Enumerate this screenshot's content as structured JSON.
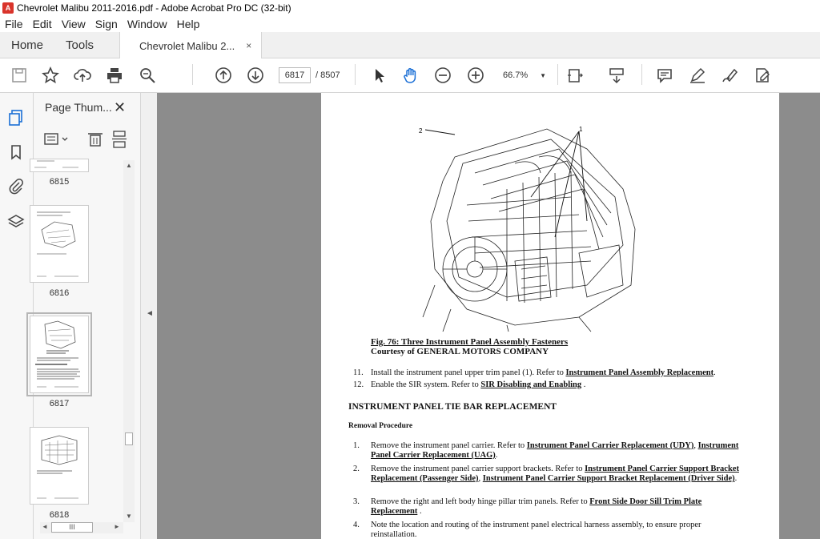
{
  "window": {
    "title": "Chevrolet Malibu 2011-2016.pdf - Adobe Acrobat Pro DC (32-bit)",
    "app_icon": "acrobat-icon"
  },
  "menu": {
    "items": [
      "File",
      "Edit",
      "View",
      "Sign",
      "Window",
      "Help"
    ]
  },
  "tabs": {
    "home": "Home",
    "tools": "Tools",
    "document": "Chevrolet Malibu 2...",
    "close": "×"
  },
  "toolbar": {
    "current_page": "6817",
    "total_pages": "/ 8507",
    "zoom": "66.7%"
  },
  "thumbnails": {
    "title": "Page Thum...",
    "close": "✕",
    "pages": [
      {
        "label": "6815"
      },
      {
        "label": "6816"
      },
      {
        "label": "6817",
        "selected": true
      },
      {
        "label": "6818"
      }
    ],
    "hscroll_label": "III"
  },
  "document": {
    "callout_2": "2",
    "callout_1": "1",
    "caption_title": "Fig. 76: Three Instrument Panel Assembly Fasteners",
    "caption_courtesy": "Courtesy of GENERAL MOTORS COMPANY",
    "step11_num": "11.",
    "step11_text": "Install the instrument panel upper trim panel (1). Refer to ",
    "step11_link": "Instrument Panel Assembly Replacement",
    "step11_end": ".",
    "step12_num": "12.",
    "step12_text": "Enable the SIR system. Refer to ",
    "step12_link": "SIR Disabling and Enabling",
    "step12_end": " .",
    "heading": "INSTRUMENT PANEL TIE BAR REPLACEMENT",
    "subheading": "Removal Procedure",
    "r1_num": "1.",
    "r1_text": "Remove the instrument panel carrier. Refer to ",
    "r1_link1": "Instrument Panel Carrier Replacement (UDY)",
    "r1_sep": ", ",
    "r1_link2": "Instrument Panel Carrier Replacement (UAG)",
    "r1_end": ".",
    "r2_num": "2.",
    "r2_text": "Remove the instrument panel carrier support brackets. Refer to ",
    "r2_link1": "Instrument Panel Carrier Support Bracket Replacement (Passenger Side)",
    "r2_sep": ", ",
    "r2_link2": "Instrument Panel Carrier Support Bracket Replacement (Driver Side)",
    "r2_end": ".",
    "r3_num": "3.",
    "r3_text": "Remove the right and left body hinge pillar trim panels. Refer to ",
    "r3_link": "Front Side Door Sill Trim Plate Replacement",
    "r3_end": " .",
    "r4_num": "4.",
    "r4_text": "Note the location and routing of the instrument panel electrical harness assembly, to ensure proper reinstallation."
  }
}
